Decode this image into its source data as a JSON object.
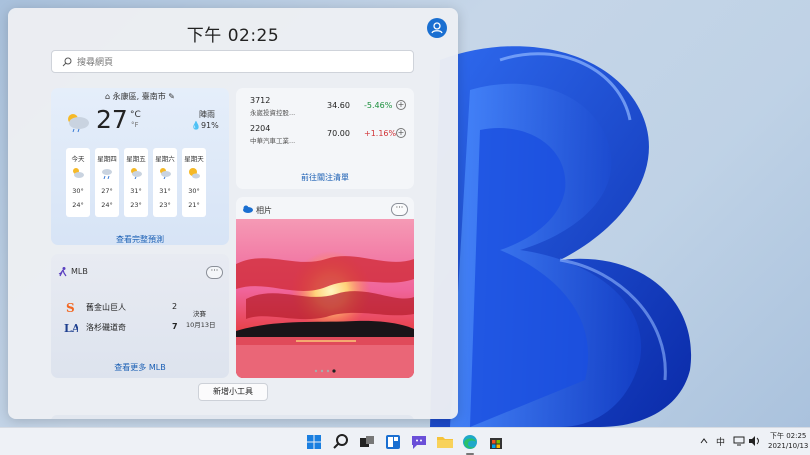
{
  "header": {
    "time": "下午 02:25"
  },
  "search": {
    "placeholder": "搜尋網頁"
  },
  "weather": {
    "location": "永康區, 臺南市",
    "temperature": "27",
    "unit_c": "°C",
    "unit_f": "°F",
    "condition": "陣雨",
    "precipitation": "91%",
    "forecast": [
      {
        "day": "今天",
        "high": "30°",
        "low": "24°"
      },
      {
        "day": "星期四",
        "high": "27°",
        "low": "24°"
      },
      {
        "day": "星期五",
        "high": "31°",
        "low": "23°"
      },
      {
        "day": "星期六",
        "high": "31°",
        "low": "23°"
      },
      {
        "day": "星期天",
        "high": "30°",
        "low": "21°"
      }
    ],
    "link": "查看完整預測"
  },
  "stocks": {
    "rows": [
      {
        "symbol": "3712",
        "name": "永崴投資控股...",
        "price": "34.60",
        "change": "-5.46%",
        "color": "#1a8f3c"
      },
      {
        "symbol": "2204",
        "name": "中華汽車工業...",
        "price": "70.00",
        "change": "+1.16%",
        "color": "#d13438"
      }
    ],
    "link": "前往關注清單"
  },
  "mlb": {
    "title": "MLB",
    "teams": [
      {
        "name": "舊金山巨人",
        "score": "2"
      },
      {
        "name": "洛杉磯道奇",
        "score": "7"
      }
    ],
    "status": "決賽",
    "date": "10月13日",
    "link": "查看更多 MLB"
  },
  "photos": {
    "title": "相片"
  },
  "add_widgets": {
    "label": "新增小工具"
  },
  "taskbar": {
    "ime": "中",
    "time": "下午 02:25",
    "date": "2021/10/13"
  },
  "colors": {
    "accent": "#1a6fd1",
    "link": "#1a5fb4"
  }
}
